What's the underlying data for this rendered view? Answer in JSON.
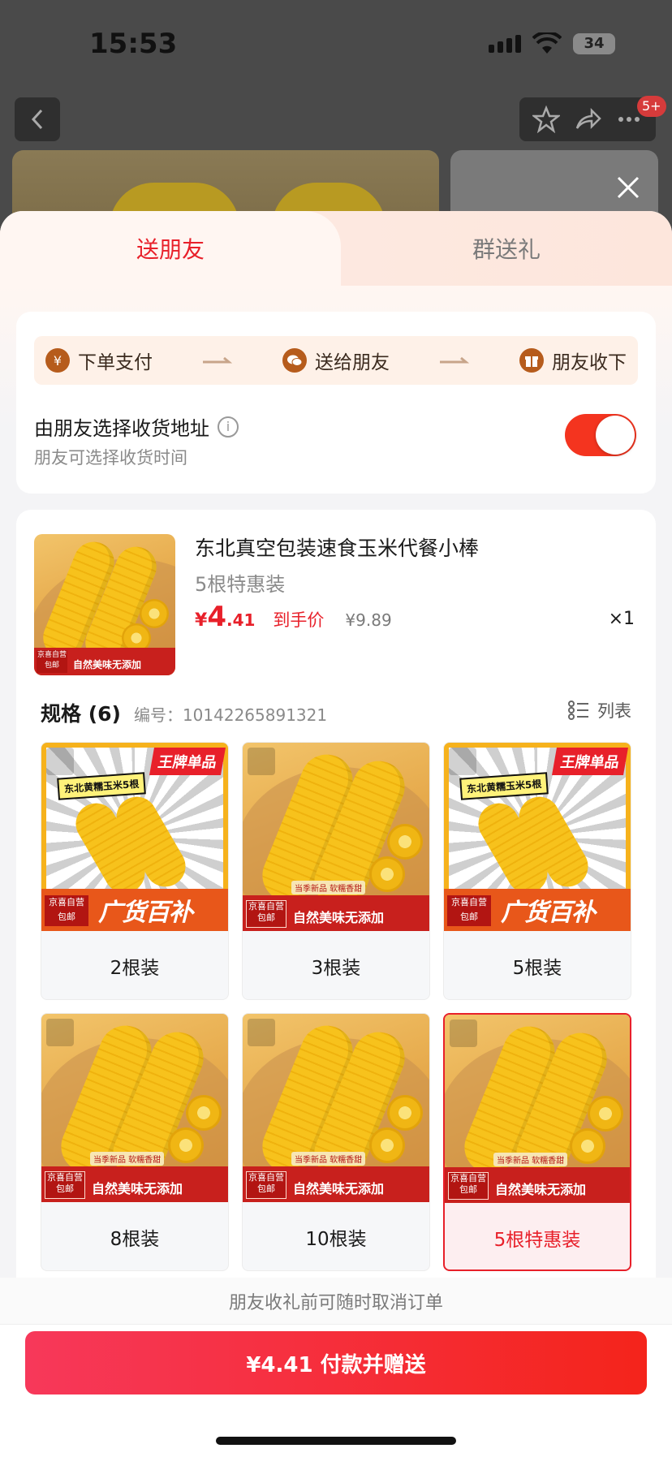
{
  "status_bar": {
    "time": "15:53",
    "battery": "34"
  },
  "header": {
    "badge": "5+"
  },
  "sheet": {
    "tabs": [
      {
        "label": "送朋友",
        "active": true
      },
      {
        "label": "群送礼",
        "active": false
      }
    ],
    "flow": [
      {
        "icon": "yen-icon",
        "label": "下单支付"
      },
      {
        "icon": "wechat-icon",
        "label": "送给朋友"
      },
      {
        "icon": "gift-icon",
        "label": "朋友收下"
      }
    ],
    "address": {
      "title": "由朋友选择收货地址",
      "subtitle": "朋友可选择收货时间",
      "toggle_on": true
    }
  },
  "product": {
    "name": "东北真空包装速食玉米代餐小棒",
    "variant": "5根特惠装",
    "price_symbol": "¥",
    "price_int": "4",
    "price_frac": ".41",
    "price_tag": "到手价",
    "original_price": "¥9.89",
    "quantity": "×1",
    "thumb_tag": "京喜自营 包邮",
    "thumb_slogan": "自然美味无添加"
  },
  "specs": {
    "title": "规格 (6)",
    "code": "编号：10142265891321",
    "list_label": "列表",
    "items": [
      {
        "label": "2根装",
        "style": "burst",
        "tag": "京喜自营 包邮",
        "banner_top": "王牌单品",
        "banner_mid": "东北黄糯玉米5根",
        "big": "广货百补",
        "selected": false
      },
      {
        "label": "3根装",
        "style": "corn",
        "tag": "京喜自营 包邮",
        "mini": "当季新品 软糯香甜",
        "slogan": "自然美味无添加",
        "selected": false
      },
      {
        "label": "5根装",
        "style": "burst",
        "tag": "京喜自营 包邮",
        "banner_top": "王牌单品",
        "banner_mid": "东北黄糯玉米5根",
        "big": "广货百补",
        "selected": false
      },
      {
        "label": "8根装",
        "style": "corn",
        "tag": "京喜自营 包邮",
        "mini": "当季新品 软糯香甜",
        "slogan": "自然美味无添加",
        "selected": false
      },
      {
        "label": "10根装",
        "style": "corn",
        "tag": "京喜自营 包邮",
        "mini": "当季新品 软糯香甜",
        "slogan": "自然美味无添加",
        "selected": false
      },
      {
        "label": "5根特惠装",
        "style": "corn",
        "tag": "京喜自营 包邮",
        "mini": "当季新品 软糯香甜",
        "slogan": "自然美味无添加",
        "selected": true
      }
    ]
  },
  "footer": {
    "cancel_note": "朋友收礼前可随时取消订单",
    "pay_button": "¥4.41 付款并赠送"
  },
  "colors": {
    "accent": "#e8202a",
    "toggle": "#f4341f",
    "flow_icon": "#b65c1c"
  }
}
